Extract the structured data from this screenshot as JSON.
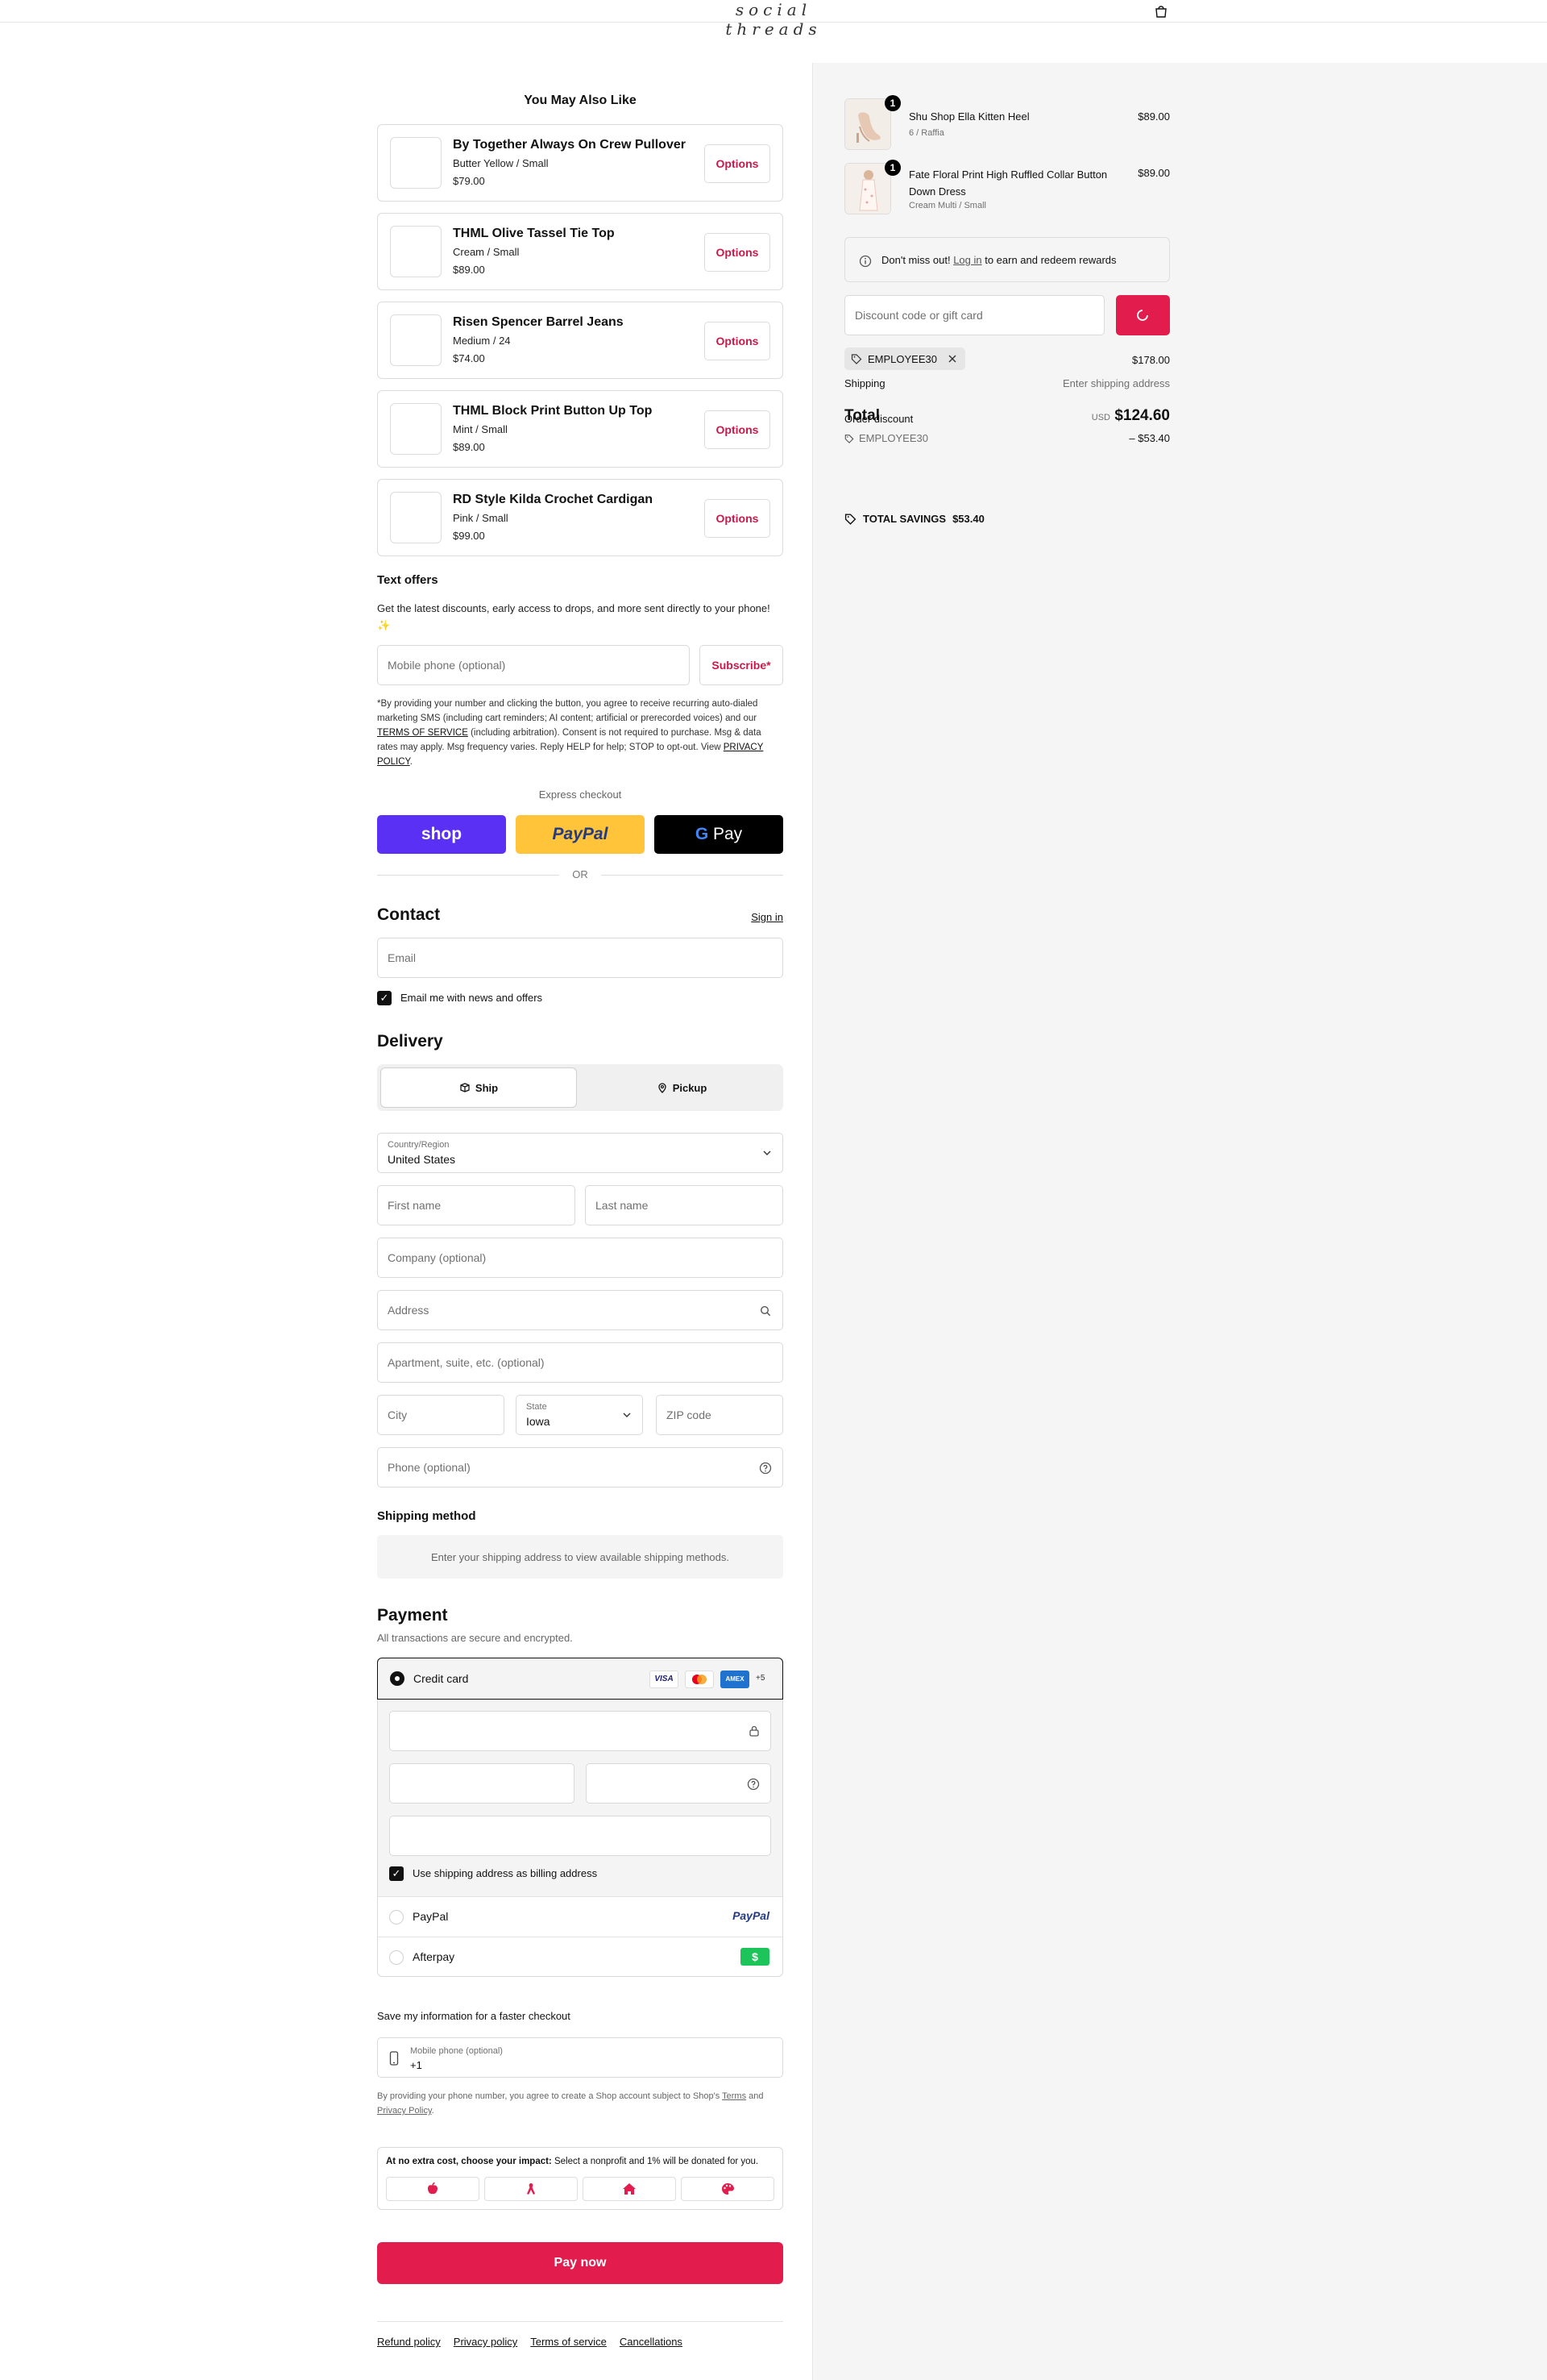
{
  "header": {
    "logo_text": "social threads"
  },
  "recommendations": {
    "title": "You May Also Like",
    "button_label": "Options",
    "items": [
      {
        "name": "By Together Always On Crew Pullover",
        "variant": "Butter Yellow / Small",
        "price": "$79.00"
      },
      {
        "name": "THML Olive Tassel Tie Top",
        "variant": "Cream / Small",
        "price": "$89.00"
      },
      {
        "name": "Risen Spencer Barrel Jeans",
        "variant": "Medium / 24",
        "price": "$74.00"
      },
      {
        "name": "THML Block Print Button Up Top",
        "variant": "Mint / Small",
        "price": "$89.00"
      },
      {
        "name": "RD Style Kilda Crochet Cardigan",
        "variant": "Pink / Small",
        "price": "$99.00"
      }
    ]
  },
  "text_offers": {
    "title": "Text offers",
    "description": "Get the latest discounts, early access to drops, and more sent directly to your phone! ✨",
    "phone_placeholder": "Mobile phone (optional)",
    "subscribe_label": "Subscribe*",
    "disclaimer_1": "*By providing your number and clicking the button, you agree to receive recurring auto-dialed marketing SMS (including cart reminders; AI content; artificial or prerecorded voices) and our ",
    "terms_link": "TERMS OF SERVICE",
    "disclaimer_2": " (including arbitration). Consent is not required to purchase. Msg & data rates may apply. Msg frequency varies. Reply HELP for help; STOP to opt-out. View ",
    "privacy_link": "PRIVACY POLICY",
    "disclaimer_3": "."
  },
  "express": {
    "title": "Express checkout",
    "shop": "shop",
    "paypal": "PayPal",
    "gpay": "Pay",
    "or": "OR"
  },
  "contact": {
    "title": "Contact",
    "sign_in": "Sign in",
    "email_placeholder": "Email",
    "news_label": "Email me with news and offers"
  },
  "delivery": {
    "title": "Delivery",
    "ship": "Ship",
    "pickup": "Pickup",
    "country_label": "Country/Region",
    "country_value": "United States",
    "first_name": "First name",
    "last_name": "Last name",
    "company": "Company (optional)",
    "address": "Address",
    "apartment": "Apartment, suite, etc. (optional)",
    "city": "City",
    "state_label": "State",
    "state_value": "Iowa",
    "zip": "ZIP code",
    "phone": "Phone (optional)"
  },
  "shipping_method": {
    "title": "Shipping method",
    "message": "Enter your shipping address to view available shipping methods."
  },
  "payment": {
    "title": "Payment",
    "subtitle": "All transactions are secure and encrypted.",
    "credit_card": "Credit card",
    "visa": "VISA",
    "amex": "AMEX",
    "more": "+5",
    "billing_label": "Use shipping address as billing address",
    "paypal": "PayPal",
    "paypal_logo": "PayPal",
    "afterpay": "Afterpay",
    "afterpay_logo": "$"
  },
  "save_info": {
    "title": "Save my information for a faster checkout",
    "phone_label": "Mobile phone (optional)",
    "phone_value": "+1",
    "note_1": "By providing your phone number, you agree to create a Shop account subject to Shop's ",
    "terms": "Terms",
    "note_2": " and ",
    "privacy": "Privacy Policy",
    "note_3": "."
  },
  "impact": {
    "title_bold": "At no extra cost, choose your impact:",
    "title_rest": " Select a nonprofit and 1% will be donated for you."
  },
  "pay_now": "Pay now",
  "footer": {
    "links": [
      "Refund policy",
      "Privacy policy",
      "Terms of service",
      "Cancellations"
    ]
  },
  "cart": {
    "items": [
      {
        "qty": "1",
        "name": "Shu Shop Ella Kitten Heel",
        "variant": "6 / Raffia",
        "price": "$89.00"
      },
      {
        "qty": "1",
        "name": "Fate Floral Print High Ruffled Collar Button Down Dress",
        "variant": "Cream Multi / Small",
        "price": "$89.00"
      }
    ],
    "rewards": {
      "before": "Don't miss out! ",
      "link": "Log in",
      "after": " to earn and redeem rewards"
    },
    "discount_placeholder": "Discount code or gift card",
    "code_tag": "EMPLOYEE30",
    "subtotal_value": "$178.00",
    "shipping_label": "Shipping",
    "shipping_value": "Enter shipping address",
    "order_discount_label": "Order discount",
    "total_label": "Total",
    "currency": "USD",
    "total_value": "$124.60",
    "discount_code": "EMPLOYEE30",
    "discount_value": "– $53.40",
    "savings_label": "TOTAL SAVINGS",
    "savings_value": "$53.40"
  },
  "colors": {
    "accent": "#e21d4d",
    "shop_purple": "#5a31f4",
    "paypal_yellow": "#ffc439",
    "amex_blue": "#1f72cd",
    "afterpay_green": "#1dc45a"
  }
}
